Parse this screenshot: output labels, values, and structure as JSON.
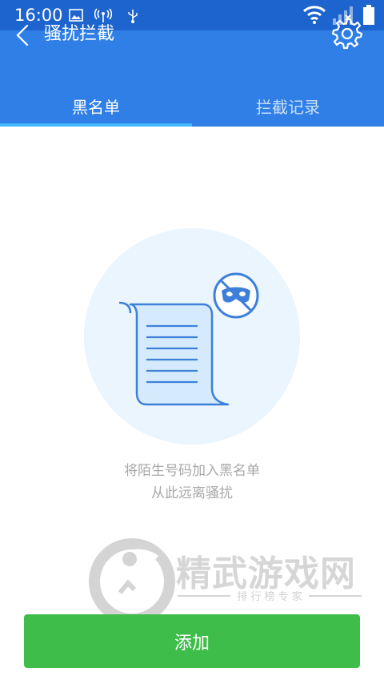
{
  "status_bar": {
    "time": "16:00",
    "icons": [
      "image-icon",
      "signal-broadcast-icon",
      "usb-icon",
      "wifi-icon",
      "cellular-signal-icon",
      "battery-icon"
    ]
  },
  "app_bar": {
    "title": "骚扰拦截",
    "back_icon": "chevron-left-icon",
    "settings_icon": "gear-icon",
    "colors": {
      "status_bar": "#1e64cf",
      "app_bar": "#2f7fe6",
      "tab_indicator": "#40b8ff"
    }
  },
  "tabs": [
    {
      "label": "黑名单",
      "active": true
    },
    {
      "label": "拦截记录",
      "active": false
    }
  ],
  "empty_state": {
    "illustration": "blacklist-scroll-mask-icon",
    "line1": "将陌生号码加入黑名单",
    "line2": "从此远离骚扰"
  },
  "watermark": {
    "brand": "精武游戏网",
    "tagline": "排 行 榜 专 家"
  },
  "primary_action": {
    "label": "添加",
    "color": "#3fbd4a"
  }
}
